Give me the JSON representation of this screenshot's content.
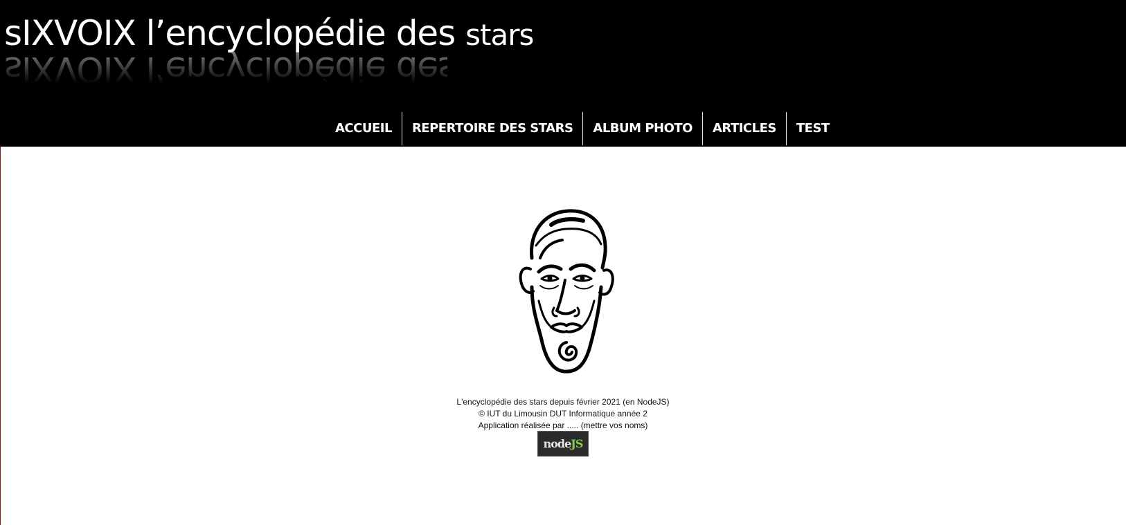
{
  "header": {
    "logo_main": "sIXVOIX l’encyclopédie des",
    "logo_stars": "stars"
  },
  "nav": {
    "items": [
      {
        "label": "ACCUEIL"
      },
      {
        "label": "REPERTOIRE DES STARS"
      },
      {
        "label": "ALBUM PHOTO"
      },
      {
        "label": "ARTICLES"
      },
      {
        "label": "TEST"
      }
    ]
  },
  "footer": {
    "line1": "L'encyclopédie des stars depuis février 2021 (en NodeJS)",
    "line2": "© IUT du Limousin DUT Informatique année 2",
    "line3": "Application réalisée par ..... (mettre vos noms)",
    "badge_node": "node",
    "badge_js": "JS"
  },
  "colors": {
    "header_bg": "#000000",
    "page_bg": "#ffffff",
    "nav_text": "#ffffff",
    "nodejs_green": "#8cc84b"
  },
  "icons": {
    "caricature": "caricature-face-icon"
  }
}
